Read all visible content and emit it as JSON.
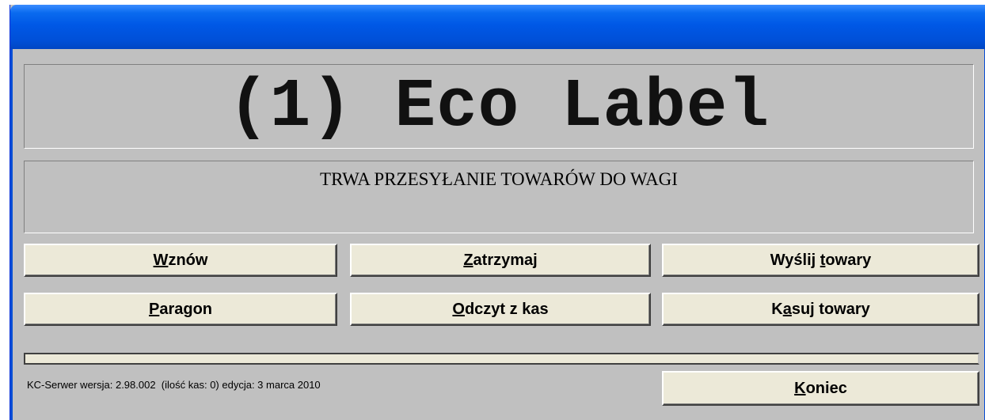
{
  "window": {
    "title": ""
  },
  "header": {
    "title": "(1) Eco Label"
  },
  "status": {
    "message": "TRWA PRZESYŁANIE TOWARÓW DO WAGI"
  },
  "buttons": {
    "resume": {
      "accel": "W",
      "rest": "znów"
    },
    "pause": {
      "accel": "Z",
      "rest": "atrzymaj"
    },
    "send_pre": "Wyślij ",
    "send_accel": "t",
    "send_rest": "owary",
    "receipt": {
      "accel": "P",
      "rest": "aragon"
    },
    "read": {
      "accel": "O",
      "rest": "dczyt z kas"
    },
    "delete_pre": "K",
    "delete_accel": "a",
    "delete_rest": "suj towary",
    "close": {
      "accel": "K",
      "rest": "oniec"
    }
  },
  "progress": {
    "value": 0
  },
  "footer": {
    "info": "KC-Serwer wersja: 2.98.002  (ilość kas: 0) edycja: 3 marca 2010"
  }
}
